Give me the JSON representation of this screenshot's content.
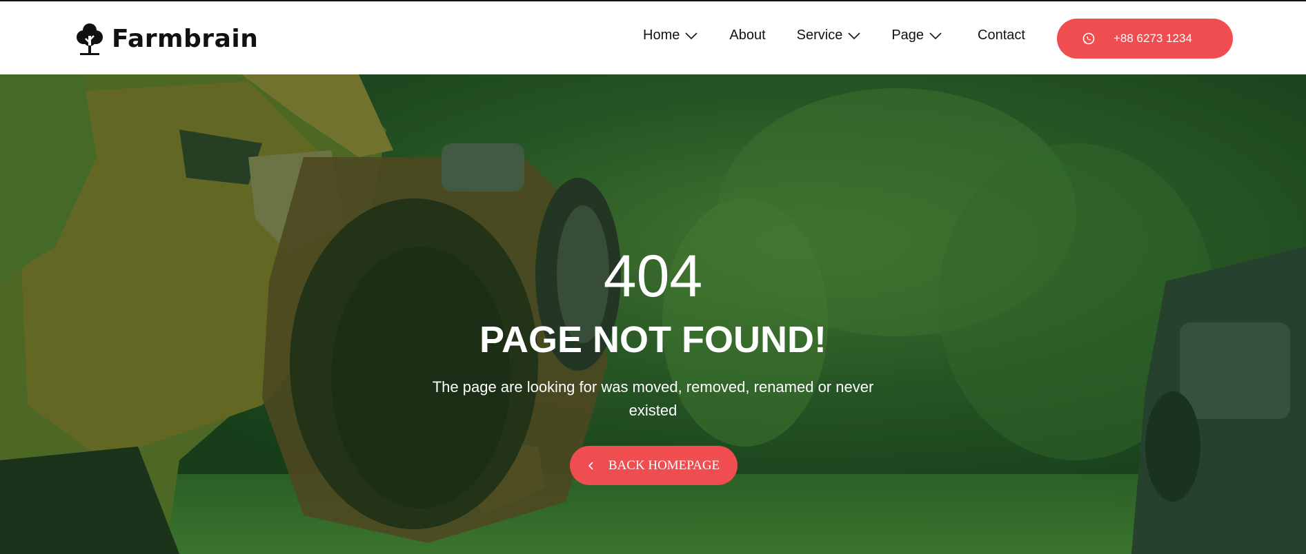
{
  "brand": {
    "name": "Farmbrain",
    "logo_icon": "tree-icon"
  },
  "nav": {
    "items": [
      {
        "label": "Home",
        "has_dropdown": true
      },
      {
        "label": "About",
        "has_dropdown": false
      },
      {
        "label": "Service",
        "has_dropdown": true
      },
      {
        "label": "Page",
        "has_dropdown": true
      },
      {
        "label": "Contact",
        "has_dropdown": false
      }
    ]
  },
  "header_cta": {
    "label": "+88 6273 1234",
    "icon": "whatsapp-icon"
  },
  "hero": {
    "code": "404",
    "title": "PAGE NOT FOUND!",
    "message": "The page are looking for was moved, removed, renamed or never existed",
    "button_label": "BACK HOMEPAGE",
    "button_icon": "chevron-left-icon"
  },
  "colors": {
    "accent": "#ef4d4f",
    "header_bg": "#ffffff",
    "overlay": "#2e6b2a"
  }
}
